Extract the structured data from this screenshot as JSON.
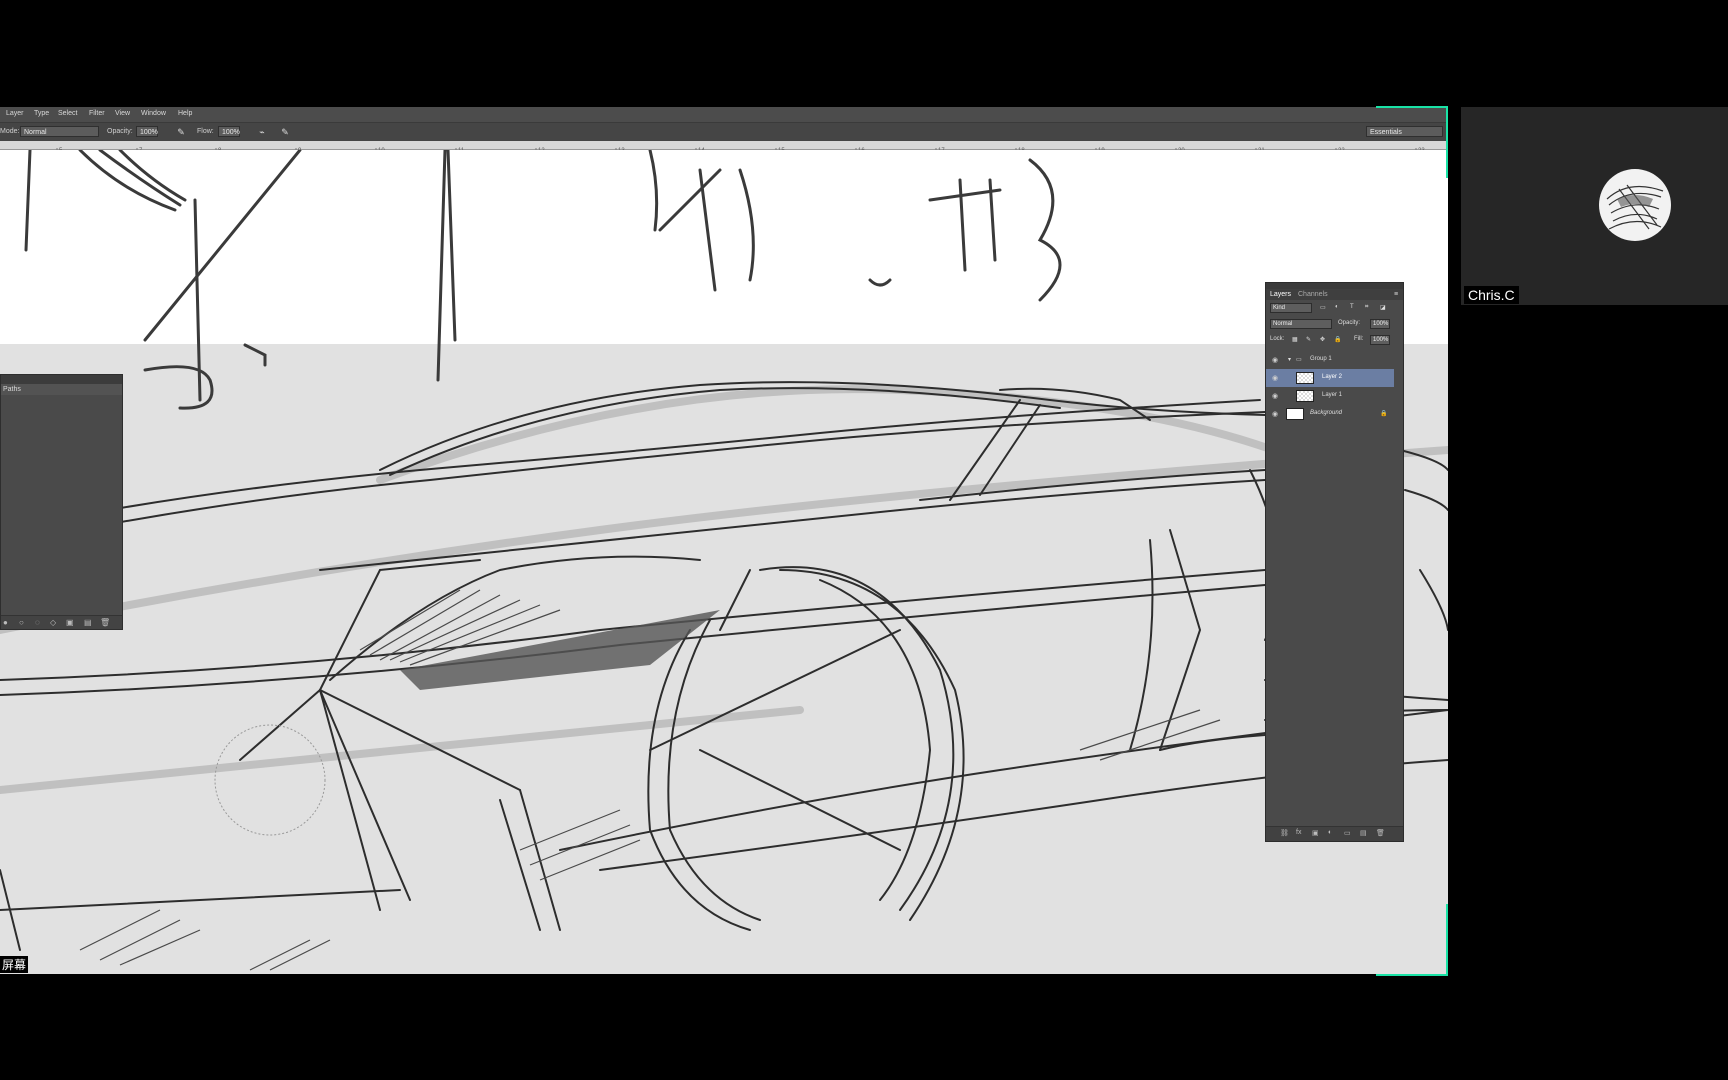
{
  "menu": [
    "Layer",
    "Type",
    "Select",
    "Filter",
    "View",
    "Window",
    "Help"
  ],
  "options_bar": {
    "mode_label": "Mode:",
    "mode_value": "Normal",
    "opacity_label": "Opacity:",
    "opacity_value": "100%",
    "flow_label": "Flow:",
    "flow_value": "100%",
    "workspace": "Essentials"
  },
  "ruler_ticks": [
    "5",
    "7",
    "8",
    "9",
    "10",
    "11",
    "12",
    "13",
    "14",
    "15",
    "16",
    "17",
    "18",
    "19",
    "20",
    "21",
    "22",
    "23"
  ],
  "paths_panel": {
    "tab": "Paths"
  },
  "layers_panel": {
    "tabs": [
      "Layers",
      "Channels"
    ],
    "kind": "Kind",
    "blend_mode": "Normal",
    "opacity_label": "Opacity:",
    "opacity_value": "100%",
    "lock_label": "Lock:",
    "fill_label": "Fill:",
    "fill_value": "100%",
    "layers": [
      {
        "name": "Group 1",
        "selected": false
      },
      {
        "name": "Layer 2",
        "selected": true
      },
      {
        "name": "Layer 1",
        "selected": false
      },
      {
        "name": "Background",
        "selected": false
      }
    ],
    "footer_icons": [
      "link-icon",
      "fx-icon",
      "mask-icon",
      "adjustment-icon",
      "folder-icon",
      "new-layer-icon",
      "trash-icon"
    ]
  },
  "participant": {
    "name": "Chris.C"
  },
  "subtitle_fragment": "屏幕",
  "colors": {
    "speaker_highlight": "#19e3a6",
    "selected_layer": "#6b7ea3"
  }
}
